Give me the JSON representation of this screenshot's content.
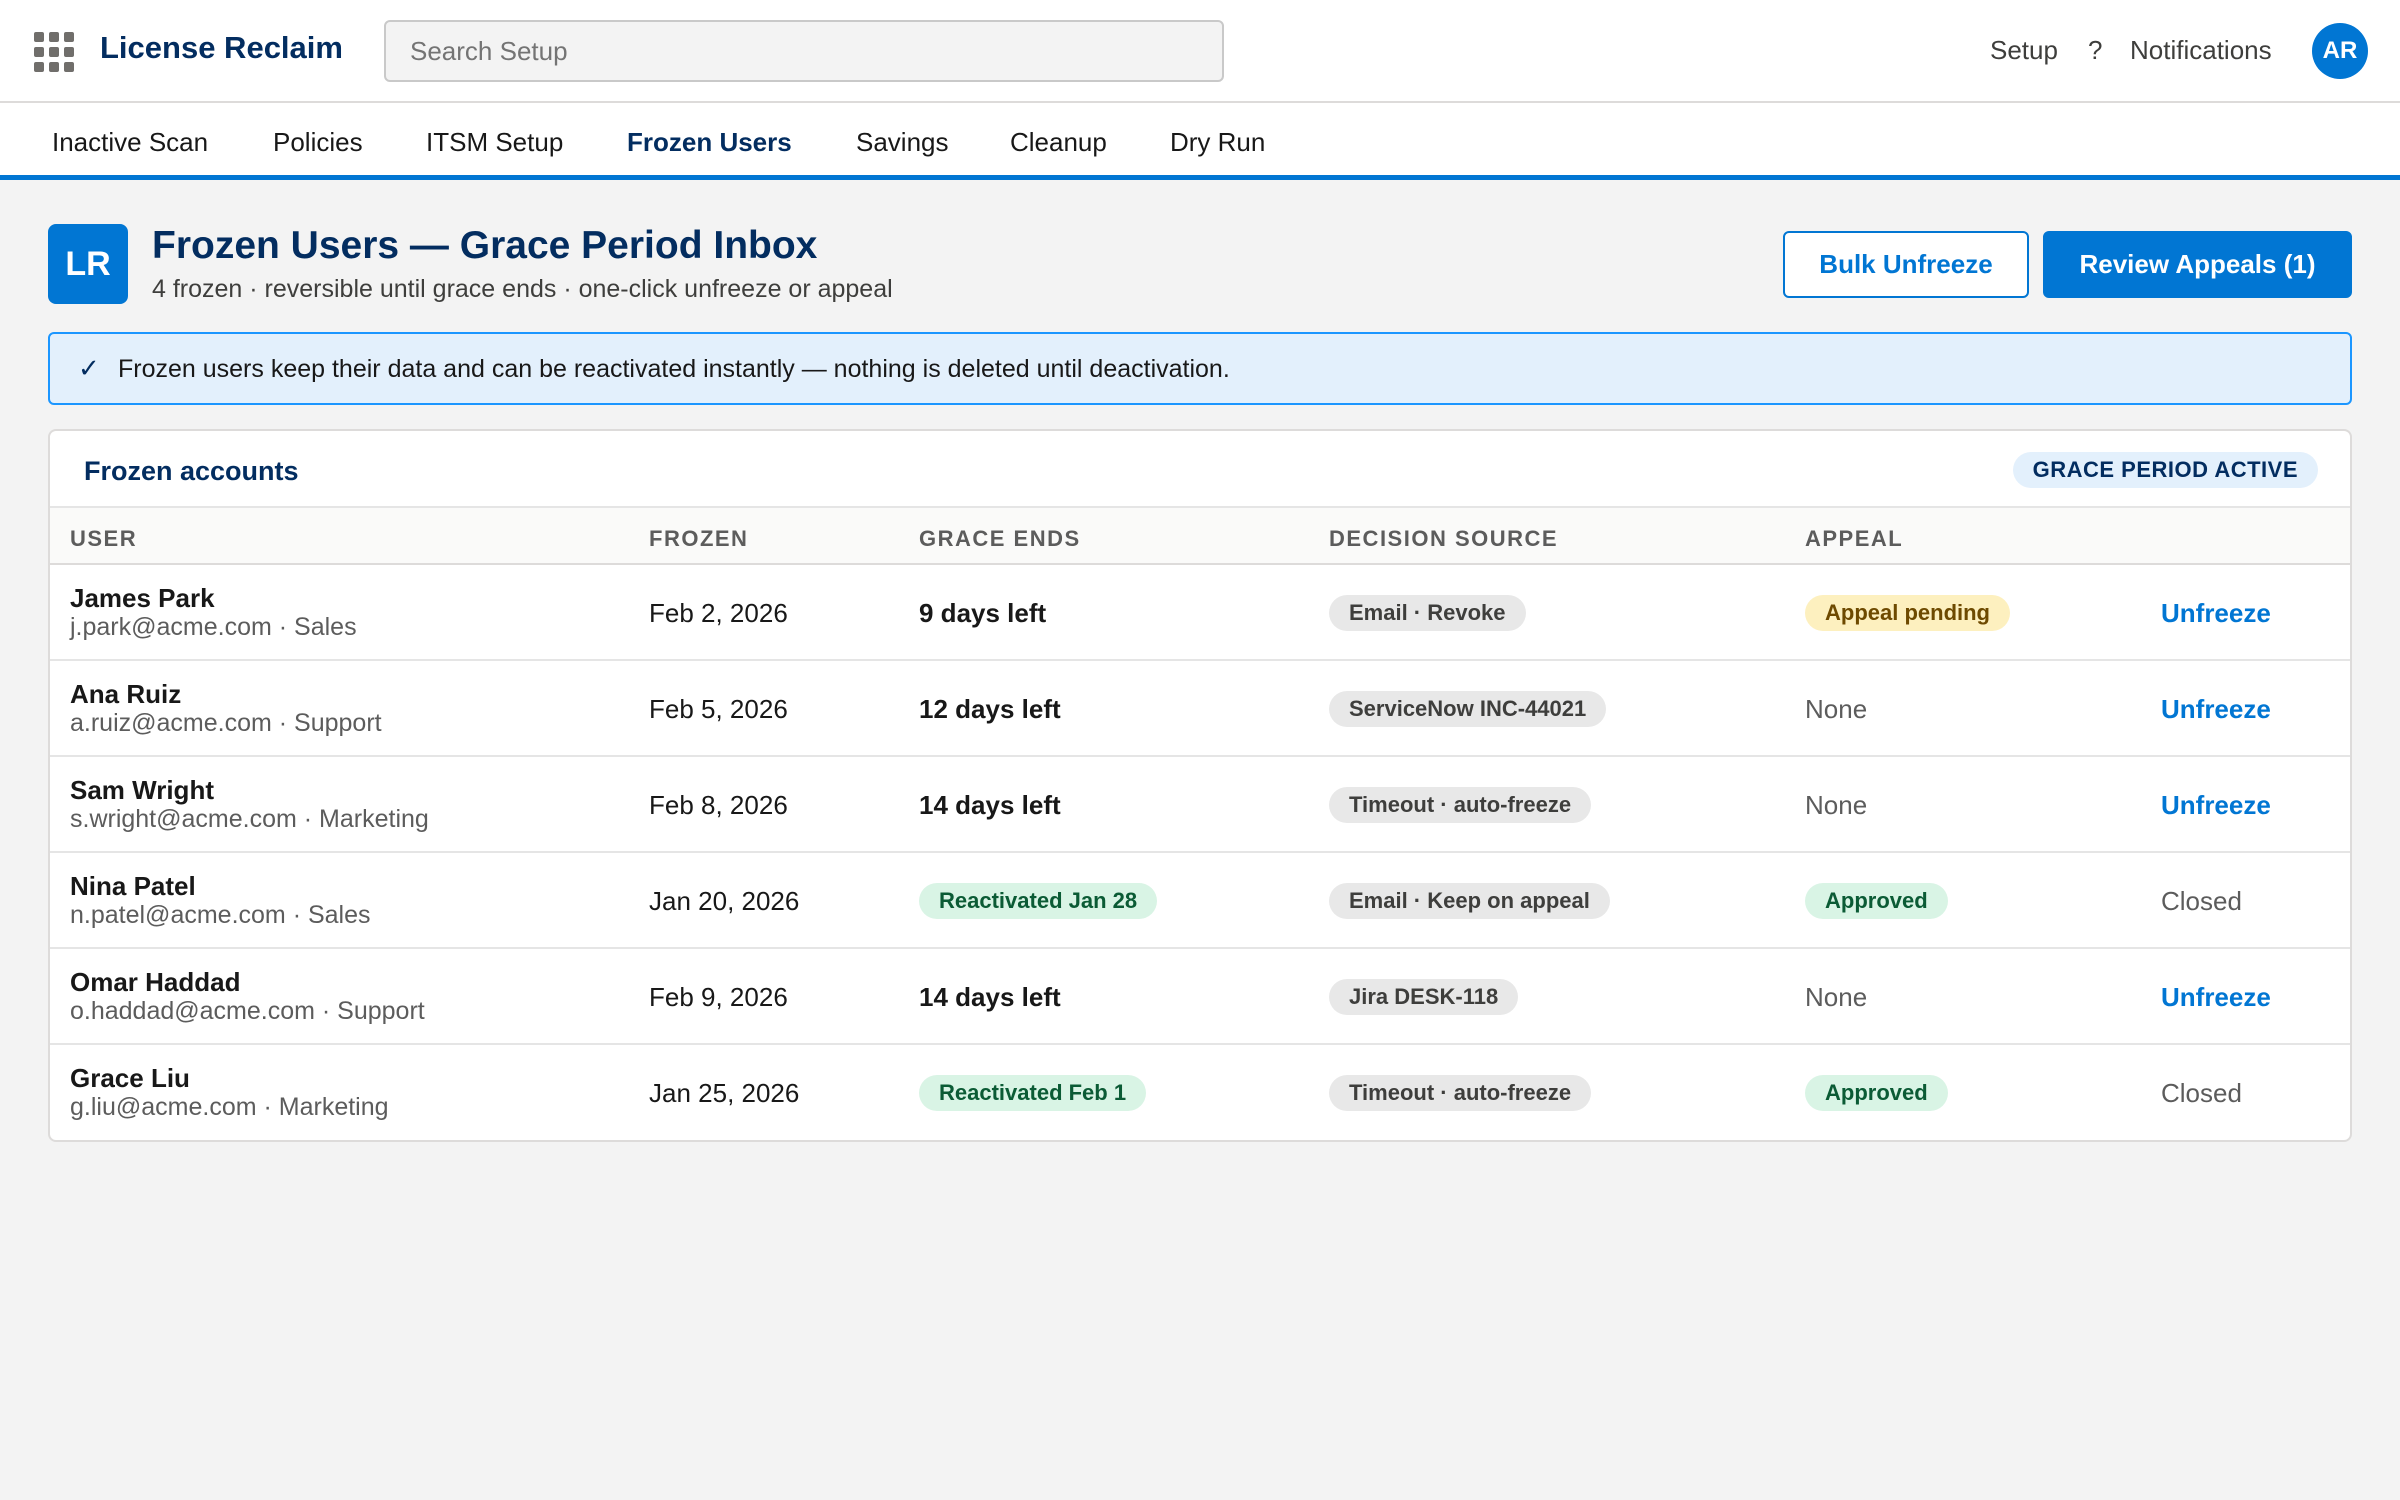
{
  "header": {
    "app_name": "License Reclaim",
    "search_placeholder": "Search Setup",
    "links": {
      "setup": "Setup",
      "help": "?",
      "notifications": "Notifications"
    },
    "avatar_initials": "AR",
    "launcher_icon": "app-launcher-icon"
  },
  "nav": {
    "tabs": [
      {
        "label": "Inactive Scan"
      },
      {
        "label": "Policies"
      },
      {
        "label": "ITSM Setup"
      },
      {
        "label": "Frozen Users",
        "active": true
      },
      {
        "label": "Savings"
      },
      {
        "label": "Cleanup"
      },
      {
        "label": "Dry Run"
      }
    ]
  },
  "page": {
    "icon_initials": "LR",
    "title": "Frozen Users — Grace Period Inbox",
    "subtitle": "4 frozen · reversible until grace ends · one-click unfreeze or appeal",
    "actions": {
      "bulk_unfreeze": "Bulk Unfreeze",
      "review_appeals": "Review Appeals (1)"
    }
  },
  "banner": {
    "icon": "✓",
    "text": "Frozen users keep their data and can be reactivated instantly — nothing is deleted until deactivation."
  },
  "card": {
    "title": "Frozen accounts",
    "badge": "GRACE PERIOD ACTIVE",
    "columns": {
      "user": "USER",
      "frozen": "FROZEN",
      "grace": "GRACE ENDS",
      "source": "DECISION SOURCE",
      "appeal": "APPEAL"
    },
    "rows": [
      {
        "name": "James Park",
        "sub": "j.park@acme.com · Sales",
        "frozen": "Feb 2, 2026",
        "grace": "9 days left",
        "grace_type": "text",
        "source": "Email · Revoke",
        "appeal": "Appeal pending",
        "appeal_type": "yellow",
        "action": "Unfreeze",
        "action_type": "link"
      },
      {
        "name": "Ana Ruiz",
        "sub": "a.ruiz@acme.com · Support",
        "frozen": "Feb 5, 2026",
        "grace": "12 days left",
        "grace_type": "text",
        "source": "ServiceNow INC-44021",
        "appeal": "None",
        "appeal_type": "text",
        "action": "Unfreeze",
        "action_type": "link"
      },
      {
        "name": "Sam Wright",
        "sub": "s.wright@acme.com · Marketing",
        "frozen": "Feb 8, 2026",
        "grace": "14 days left",
        "grace_type": "text",
        "source": "Timeout · auto-freeze",
        "appeal": "None",
        "appeal_type": "text",
        "action": "Unfreeze",
        "action_type": "link"
      },
      {
        "name": "Nina Patel",
        "sub": "n.patel@acme.com · Sales",
        "frozen": "Jan 20, 2026",
        "grace": "Reactivated Jan 28",
        "grace_type": "pill",
        "source": "Email · Keep on appeal",
        "appeal": "Approved",
        "appeal_type": "green",
        "action": "Closed",
        "action_type": "text"
      },
      {
        "name": "Omar Haddad",
        "sub": "o.haddad@acme.com · Support",
        "frozen": "Feb 9, 2026",
        "grace": "14 days left",
        "grace_type": "text",
        "source": "Jira DESK-118",
        "appeal": "None",
        "appeal_type": "text",
        "action": "Unfreeze",
        "action_type": "link"
      },
      {
        "name": "Grace Liu",
        "sub": "g.liu@acme.com · Marketing",
        "frozen": "Jan 25, 2026",
        "grace": "Reactivated Feb 1",
        "grace_type": "pill",
        "source": "Timeout · auto-freeze",
        "appeal": "Approved",
        "appeal_type": "green",
        "action": "Closed",
        "action_type": "text"
      }
    ]
  }
}
